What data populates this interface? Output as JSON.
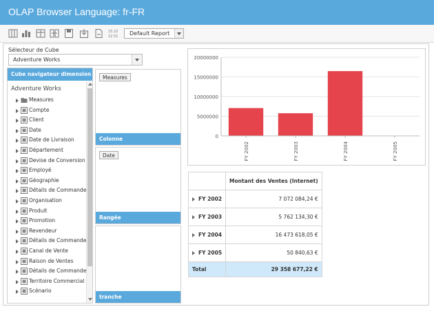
{
  "title": "OLAP Browser Language: fr-FR",
  "toolbar": {
    "icons": [
      "grid-toggle-icon",
      "chart-icon",
      "table-icon",
      "column-swap-icon",
      "save-icon",
      "load-icon",
      "export-icon",
      "number-format-icon"
    ],
    "report_select": "Default Report"
  },
  "cube": {
    "label": "Sélecteur de Cube",
    "selected": "Adventure Works"
  },
  "navigator": {
    "header": "Cube navigateur dimension",
    "root": "Adventure Works",
    "items": [
      "Measures",
      "Compte",
      "Client",
      "Date",
      "Date de Livraison",
      "Département",
      "Devise de Conversion",
      "Employé",
      "Géographie",
      "Détails de Commandes (In",
      "Organisation",
      "Produit",
      "Promotion",
      "Revendeur",
      "Détails de Commandes (R",
      "Canal de Vente",
      "Raison de Ventes",
      "Détails de Commandes Ce",
      "Territoire Commercial",
      "Scénario"
    ]
  },
  "axes": {
    "column": {
      "label": "Colonne",
      "chip": "Measures"
    },
    "row": {
      "label": "Rangée",
      "chip": "Date"
    },
    "slicer": {
      "label": "tranche"
    }
  },
  "chart_data": {
    "type": "bar",
    "categories": [
      "FY 2002",
      "FY 2003",
      "FY 2004",
      "FY 2005"
    ],
    "values": [
      7072084.24,
      5762134.3,
      16473618.05,
      50840.63
    ],
    "ylim": [
      0,
      20000000
    ],
    "yticks": [
      "0",
      "5000000",
      "10000000",
      "15000000",
      "20000000"
    ],
    "bar_color": "#e5444d",
    "grid": true
  },
  "grid": {
    "header": "Montant des Ventes (Internet)",
    "rows": [
      {
        "label": "FY 2002",
        "value": "7 072 084,24 €"
      },
      {
        "label": "FY 2003",
        "value": "5 762 134,30 €"
      },
      {
        "label": "FY 2004",
        "value": "16 473 618,05 €"
      },
      {
        "label": "FY 2005",
        "value": "50 840,63 €"
      }
    ],
    "total_label": "Total",
    "total_value": "29 358 677,22 €",
    "total_bg": "#cfe9fa"
  }
}
